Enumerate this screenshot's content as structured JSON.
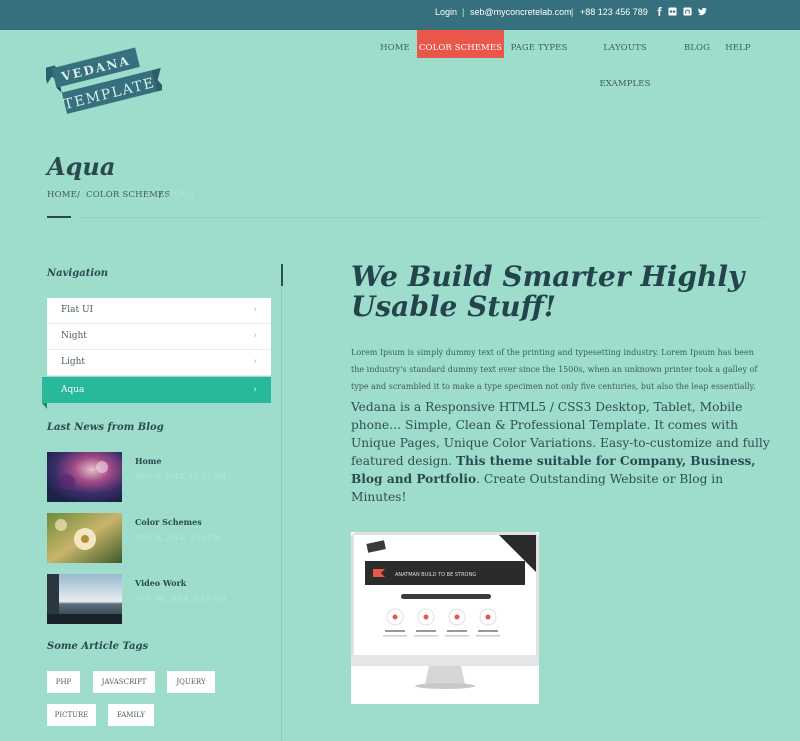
{
  "topbar": {
    "login": "Login",
    "separator": "|",
    "email": "seb@myconcretelab.com",
    "phone": "+88 123 456 789",
    "social": [
      "facebook-icon",
      "flickr-icon",
      "github-icon",
      "twitter-icon"
    ]
  },
  "logo": {
    "line1": "VEDANA",
    "line2": "TEMPLATE"
  },
  "nav": [
    "HOME",
    "COLOR SCHEMES",
    "PAGE TYPES",
    "LAYOUTS EXAMPLES",
    "BLOG",
    "HELP"
  ],
  "nav_active": "COLOR SCHEMES",
  "page": {
    "title": "Aqua",
    "breadcrumb": [
      "HOME",
      "COLOR SCHEMES",
      "AQUA"
    ],
    "breadcrumb_sep": "/"
  },
  "sidebar": {
    "navigation_heading": "Navigation",
    "nav_items": [
      {
        "label": "Flat UI",
        "chev": "›"
      },
      {
        "label": "Night",
        "chev": "›"
      },
      {
        "label": "Light",
        "chev": "›"
      },
      {
        "label": "Aqua",
        "chev": "›"
      }
    ],
    "news_heading": "Last News from Blog",
    "news": [
      {
        "title": "Home",
        "date": "NOV 8, 2014, 11:31 AM"
      },
      {
        "title": "Color Schemes",
        "date": "NOV 8, 2014, 3:50 PM"
      },
      {
        "title": "Video Work",
        "date": "NOV 08, 2014, 9:15 AM"
      }
    ],
    "tags_heading": "Some Article Tags",
    "tags": [
      "PHP",
      "JAVASCRIPT",
      "JQUERY",
      "PICTURE",
      "FAMILY"
    ]
  },
  "main": {
    "headline": "We Build Smarter Highly Usable Stuff!",
    "lorem": "Lorem Ipsum is simply dummy text of the printing and typesetting industry. Lorem Ipsum has been the industry's standard dummy text ever since the 1500s, when an unknown printer took a galley of type and scrambled it to make a type specimen not only five centuries, but also the leap essentially.",
    "intro": "Vedana is a Responsive HTML5 / CSS3 Desktop, Tablet, Mobile phone… Simple, Clean & Professional Template. It comes with Unique Pages, Unique Color Variations. Easy-to-customize and fully featured design.",
    "intro_bold": "This theme suitable for Company, Business, Blog and Portfolio",
    "intro_end": ". Create Outstanding Website or Blog in Minutes!"
  },
  "screenshot": {
    "banner": "ANATMAN BUILD TO BE STRONG"
  },
  "colors": {
    "background": "#9edccb",
    "topbar": "#36707e",
    "nav_active": "#e8574a",
    "accent": "#27b999",
    "heading": "#2a4a52"
  }
}
